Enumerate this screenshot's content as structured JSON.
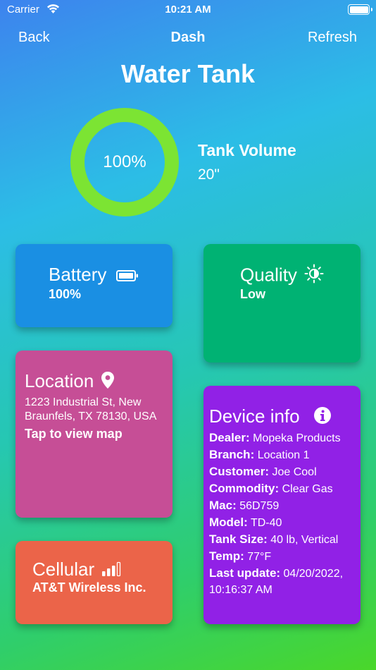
{
  "status": {
    "carrier": "Carrier",
    "time": "10:21 AM"
  },
  "nav": {
    "back": "Back",
    "title": "Dash",
    "refresh": "Refresh"
  },
  "page": {
    "title": "Water Tank"
  },
  "tank": {
    "percent_label": "100%",
    "percent_value": 100,
    "volume_title": "Tank Volume",
    "volume_value": "20\"",
    "ring_color": "#7ce433"
  },
  "cards": {
    "battery": {
      "title": "Battery",
      "value": "100%",
      "icon": "battery-icon",
      "color": "#1a8fe3"
    },
    "quality": {
      "title": "Quality",
      "value": "Low",
      "icon": "brightness-icon",
      "color": "#00b273"
    },
    "location": {
      "title": "Location",
      "icon": "map-pin-icon",
      "address": "1223 Industrial St, New Braunfels, TX 78130, USA",
      "link": "Tap to view map",
      "color": "#c64e96"
    },
    "cellular": {
      "title": "Cellular",
      "value": "AT&T Wireless Inc.",
      "icon": "signal-bars-icon",
      "color": "#eb6449"
    },
    "device": {
      "title": "Device info",
      "icon": "info-icon",
      "color": "#9121e6",
      "rows": [
        {
          "key": "Dealer:",
          "value": "Mopeka Products"
        },
        {
          "key": "Branch:",
          "value": "Location 1"
        },
        {
          "key": "Customer:",
          "value": "Joe Cool"
        },
        {
          "key": "Commodity:",
          "value": "Clear Gas"
        },
        {
          "key": "Mac:",
          "value": "56D759"
        },
        {
          "key": "Model:",
          "value": "TD-40"
        },
        {
          "key": "Tank Size:",
          "value": "40 lb, Vertical"
        },
        {
          "key": "Temp:",
          "value": "77°F"
        },
        {
          "key": "Last update:",
          "value": "04/20/2022, 10:16:37 AM"
        }
      ]
    }
  }
}
